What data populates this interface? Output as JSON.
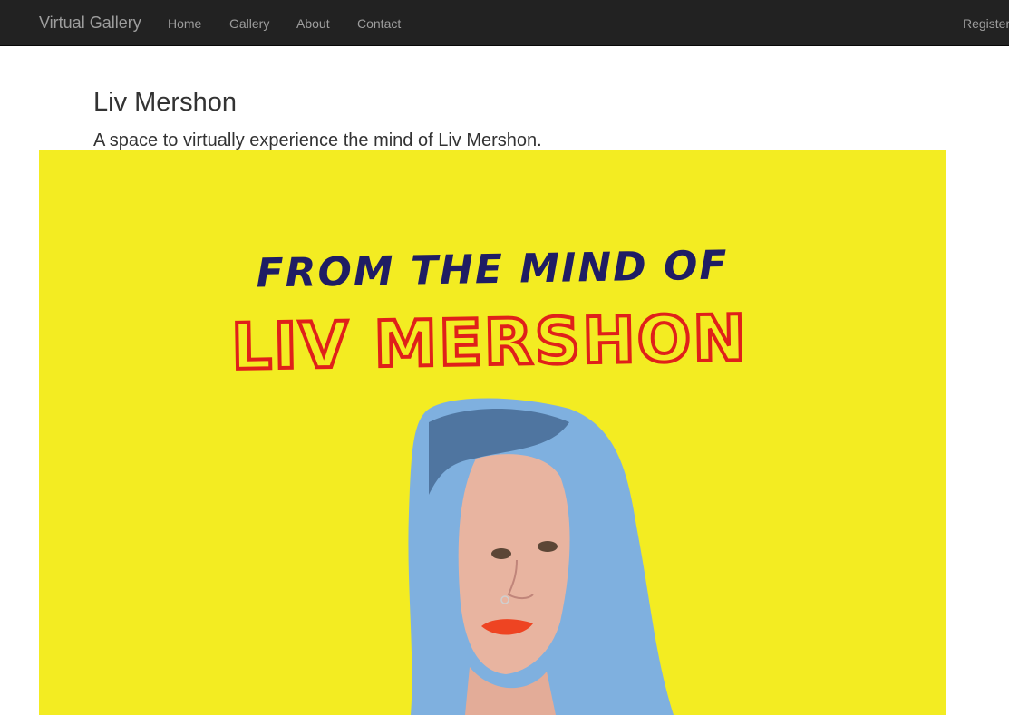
{
  "navbar": {
    "brand": "Virtual Gallery",
    "links": [
      "Home",
      "Gallery",
      "About",
      "Contact"
    ],
    "register": "Register"
  },
  "page": {
    "title": "Liv Mershon",
    "subtitle": "A space to virtually experience the mind of Liv Mershon."
  },
  "hero": {
    "line1": "FROM THE MIND OF",
    "line2": "LIV MERSHON",
    "colors": {
      "background": "#f3ec22",
      "line1": "#1f1d64",
      "line2_outline": "#e0201a",
      "hair": "#7fb0df",
      "lips": "#ee4422"
    }
  }
}
